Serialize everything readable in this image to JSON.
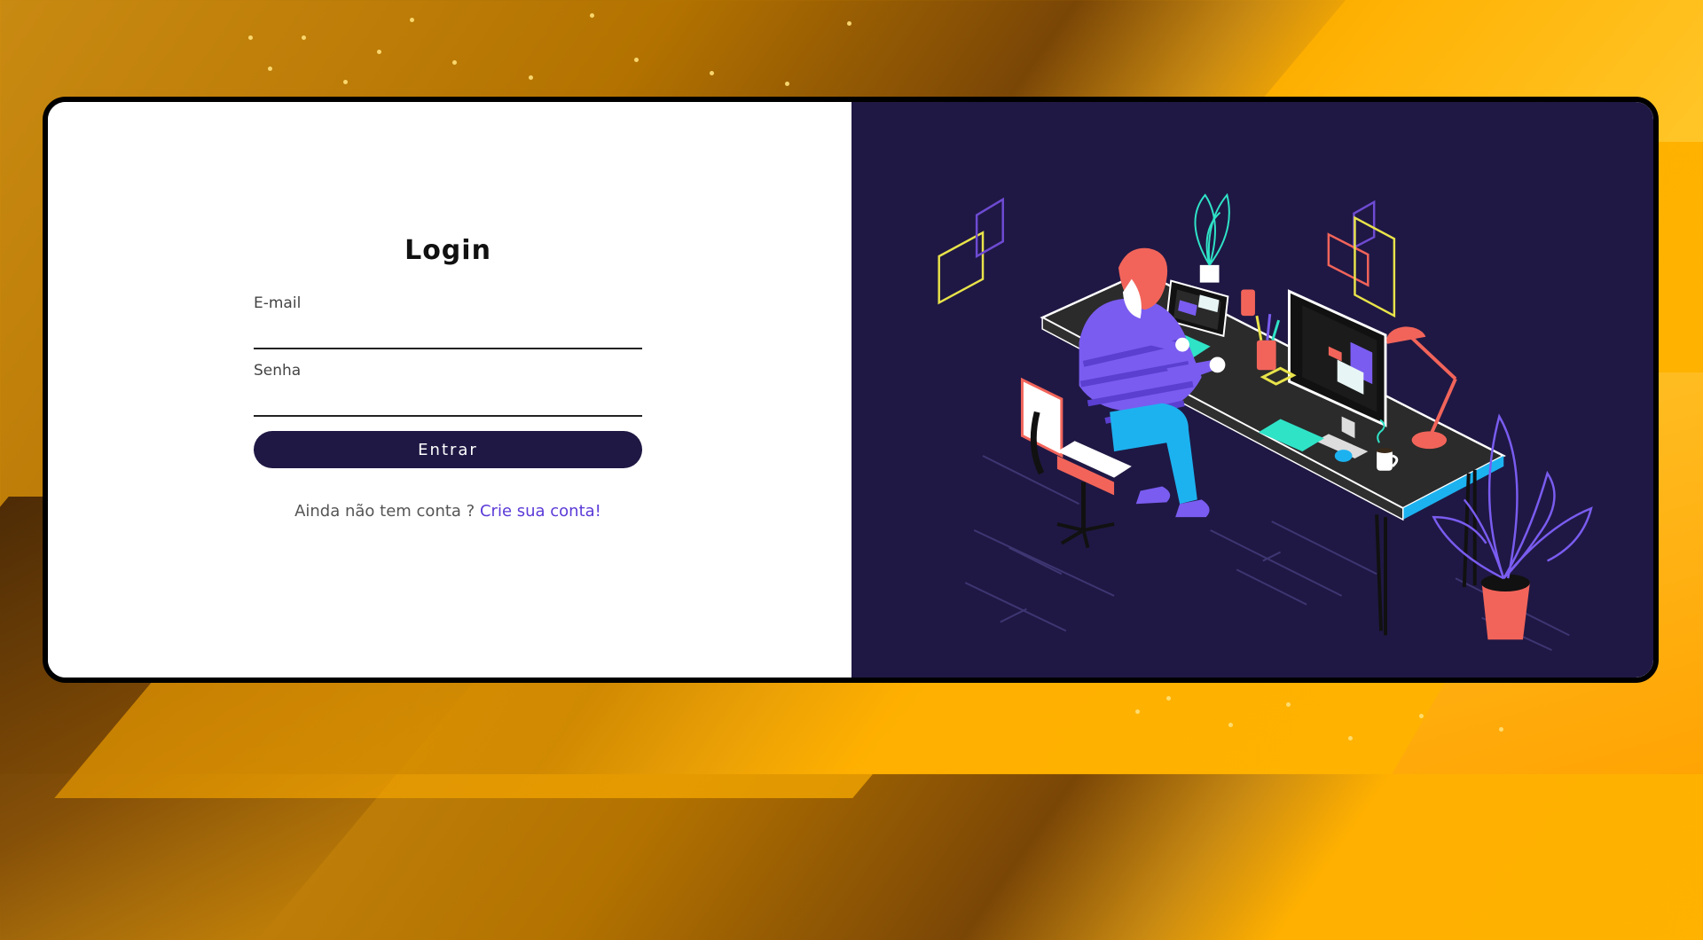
{
  "login": {
    "title": "Login",
    "email_label": "E-mail",
    "password_label": "Senha",
    "submit_label": "Entrar",
    "signup_prompt": "Ainda não tem conta ?",
    "signup_link": "Crie sua conta!"
  },
  "colors": {
    "panel_dark": "#1f1844",
    "button_bg": "#1f1844",
    "link": "#5b3ad8",
    "background_orange": "#ffb000"
  },
  "illustration": {
    "icon": "person-at-desk-illustration"
  }
}
